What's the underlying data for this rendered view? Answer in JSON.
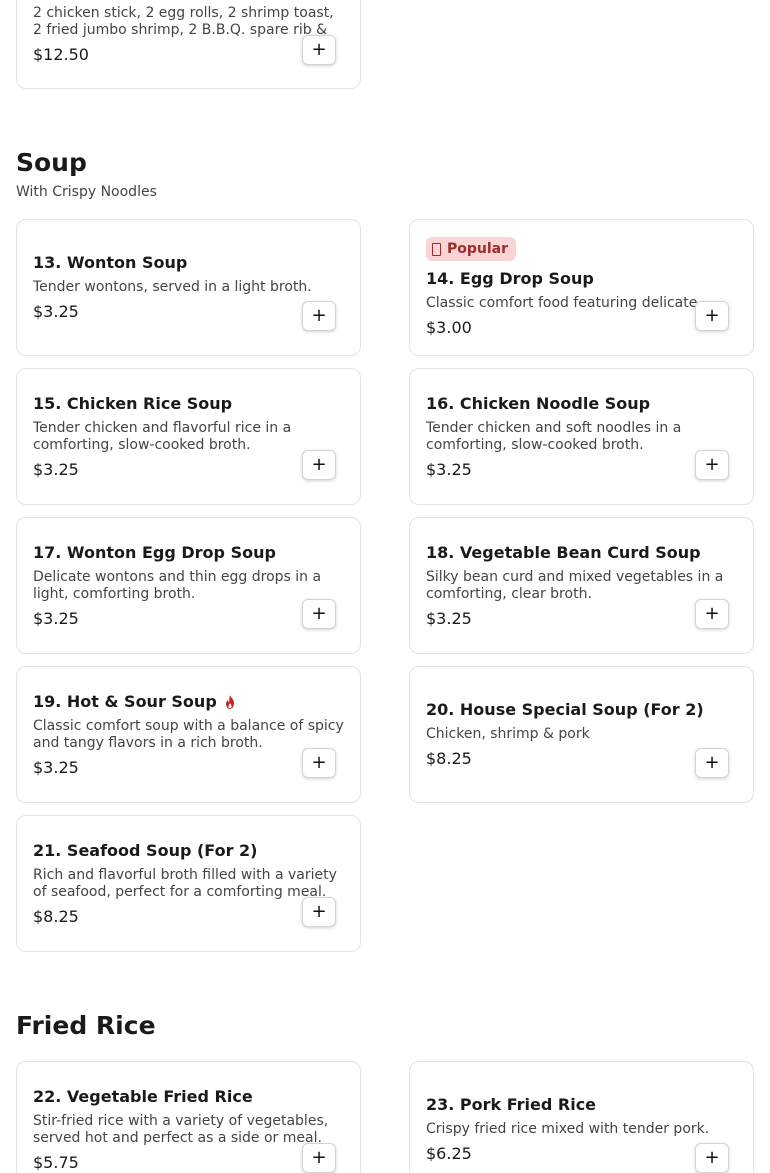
{
  "top_card": {
    "desc": "2 chicken stick, 2 egg rolls, 2 shrimp toast, 2 fried jumbo shrimp, 2 B.B.Q. spare rib & ...",
    "price": "$12.50"
  },
  "add_label": "+",
  "soup": {
    "title": "Soup",
    "subtitle": "With Crispy Noodles",
    "items": [
      {
        "name": "13. Wonton Soup",
        "desc": "Tender wontons, served in a light broth.",
        "price": "$3.25"
      },
      {
        "name": "14. Egg Drop Soup",
        "desc": "Classic comfort food featuring delicate ...",
        "price": "$3.00",
        "badge": "Popular"
      },
      {
        "name": "15. Chicken Rice Soup",
        "desc": "Tender chicken and flavorful rice in a comforting, slow-cooked broth.",
        "price": "$3.25"
      },
      {
        "name": "16. Chicken Noodle Soup",
        "desc": "Tender chicken and soft noodles in a comforting, slow-cooked broth.",
        "price": "$3.25"
      },
      {
        "name": "17. Wonton Egg Drop Soup",
        "desc": "Delicate wontons and thin egg drops in a light, comforting broth.",
        "price": "$3.25"
      },
      {
        "name": "18. Vegetable Bean Curd Soup",
        "desc": "Silky bean curd and mixed vegetables in a comforting, clear broth.",
        "price": "$3.25"
      },
      {
        "name": "19. Hot & Sour Soup",
        "desc": "Classic comfort soup with a balance of spicy and tangy flavors in a rich broth.",
        "price": "$3.25",
        "icon": "spicy-flame-icon"
      },
      {
        "name": "20. House Special Soup (For 2)",
        "desc": "Chicken, shrimp & pork",
        "price": "$8.25"
      },
      {
        "name": "21. Seafood Soup (For 2)",
        "desc": "Rich and flavorful broth filled with a variety of seafood, perfect for a comforting meal.",
        "price": "$8.25"
      }
    ]
  },
  "fried_rice": {
    "title": "Fried Rice",
    "items": [
      {
        "name": "22. Vegetable Fried Rice",
        "desc": "Stir-fried rice with a variety of vegetables, served hot and perfect as a side or meal.",
        "price": "$5.75"
      },
      {
        "name": "23. Pork Fried Rice",
        "desc": "Crispy fried rice mixed with tender pork.",
        "price": "$6.25"
      }
    ]
  },
  "colors": {
    "badge_bg": "#fbd5d5",
    "badge_text": "#9b2c2c",
    "spicy": "#c62828",
    "card_border": "#e3e3e3"
  }
}
